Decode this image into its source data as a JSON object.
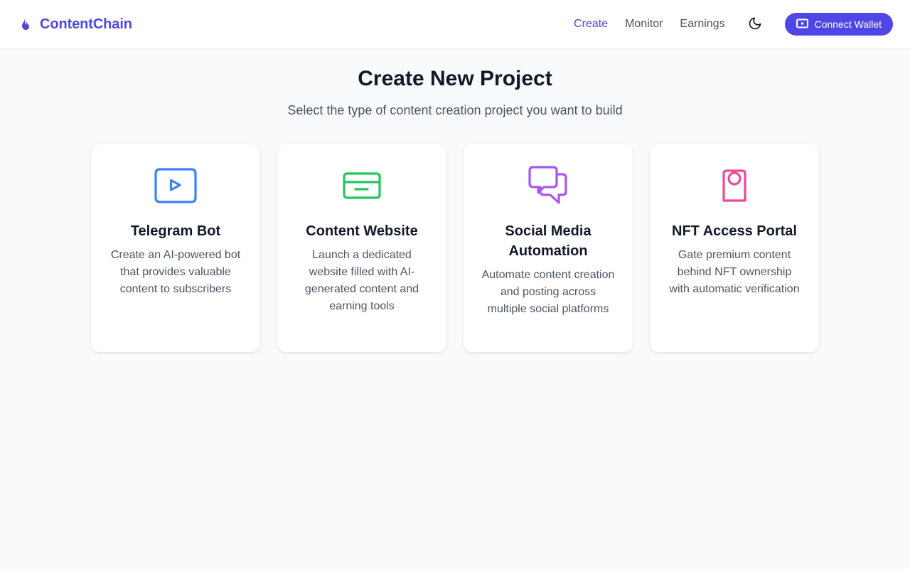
{
  "header": {
    "brand": "ContentChain",
    "brand_icon": "flame-icon",
    "brand_color": "#4f46e5",
    "nav": [
      {
        "label": "Create",
        "active": true
      },
      {
        "label": "Monitor",
        "active": false
      },
      {
        "label": "Earnings",
        "active": false
      }
    ],
    "theme_icon": "moon-icon",
    "wallet_button": {
      "label": "Connect Wallet",
      "icon": "wallet-icon"
    }
  },
  "main": {
    "title": "Create New Project",
    "subtitle": "Select the type of content creation project you want to build",
    "cards": [
      {
        "title": "Telegram Bot",
        "description": "Create an AI-powered bot that provides valuable content to subscribers",
        "icon": "video-play-icon",
        "color": "#3b82f6"
      },
      {
        "title": "Content Website",
        "description": "Launch a dedicated website filled with AI-generated content and earning tools",
        "icon": "card-icon",
        "color": "#22c55e"
      },
      {
        "title": "Social Media Automation",
        "description": "Automate content creation and posting across multiple social platforms",
        "icon": "chat-bubbles-icon",
        "color": "#a855f7"
      },
      {
        "title": "NFT Access Portal",
        "description": "Gate premium content behind NFT ownership with automatic verification",
        "icon": "badge-icon",
        "color": "#ec4899"
      }
    ]
  }
}
